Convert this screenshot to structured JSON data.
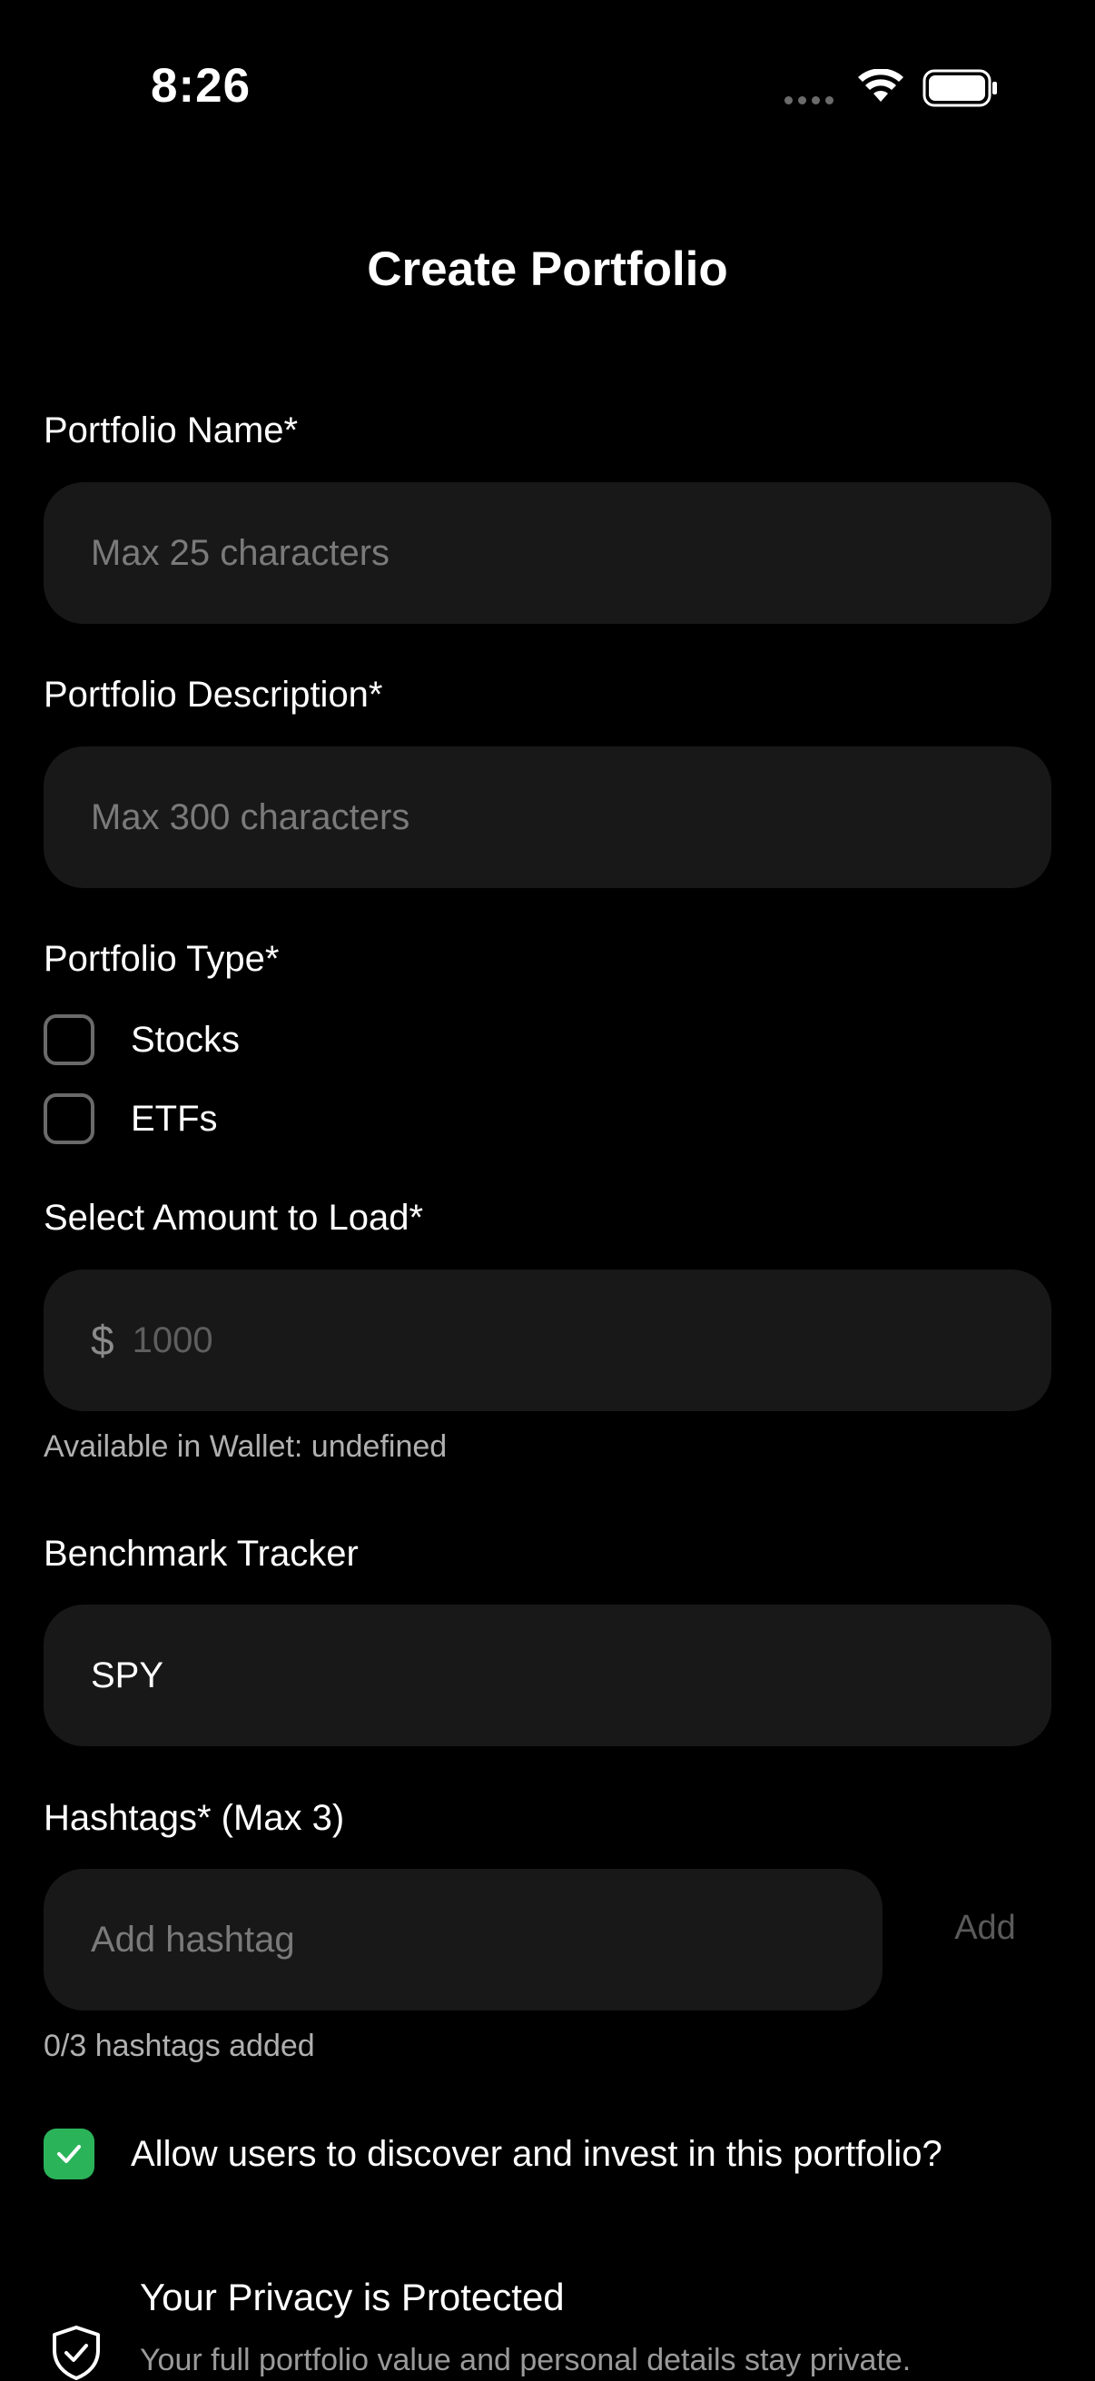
{
  "status_bar": {
    "time": "8:26"
  },
  "title": "Create Portfolio",
  "portfolio_name": {
    "label": "Portfolio Name*",
    "placeholder": "Max 25 characters"
  },
  "portfolio_description": {
    "label": "Portfolio Description*",
    "placeholder": "Max 300 characters"
  },
  "portfolio_type": {
    "label": "Portfolio Type*",
    "options": [
      {
        "label": "Stocks",
        "checked": false
      },
      {
        "label": "ETFs",
        "checked": false
      }
    ]
  },
  "amount": {
    "label": "Select Amount to Load*",
    "currency_symbol": "$",
    "placeholder": "1000",
    "wallet_text": "Available in Wallet: undefined"
  },
  "benchmark": {
    "label": "Benchmark Tracker",
    "value": "SPY"
  },
  "hashtags": {
    "label": "Hashtags* (Max 3)",
    "placeholder": "Add hashtag",
    "add_label": "Add",
    "count_text": "0/3 hashtags added"
  },
  "discover": {
    "label": "Allow users to discover and invest in this portfolio?",
    "checked": true
  },
  "privacy": {
    "title": "Your Privacy is Protected",
    "text": "Your full portfolio value and personal details stay private."
  },
  "colors": {
    "background": "#000000",
    "input_background": "#181818",
    "accent_green": "#2bb35a",
    "placeholder": "#7a7a7a"
  },
  "icons": {
    "wifi": "wifi-icon",
    "battery": "battery-icon",
    "signal": "cellular-signal-icon",
    "checkmark": "checkmark-icon",
    "shield": "shield-check-icon"
  }
}
